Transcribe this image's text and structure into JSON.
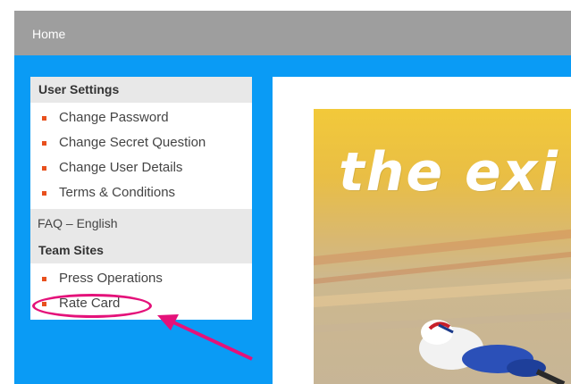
{
  "topbar": {
    "home_label": "Home"
  },
  "sidebar": {
    "user_settings": {
      "title": "User Settings",
      "items": [
        {
          "label": "Change Password"
        },
        {
          "label": "Change Secret Question"
        },
        {
          "label": "Change User Details"
        },
        {
          "label": "Terms & Conditions"
        }
      ]
    },
    "faq_label": "FAQ – English",
    "team_sites": {
      "title": "Team Sites",
      "items": [
        {
          "label": "Press Operations"
        },
        {
          "label": "Rate Card"
        }
      ]
    }
  },
  "hero": {
    "headline": "the exi"
  },
  "colors": {
    "topbar": "#9e9e9e",
    "background": "#0a9bf5",
    "bullet": "#e8501d",
    "highlight": "#e4127a"
  }
}
